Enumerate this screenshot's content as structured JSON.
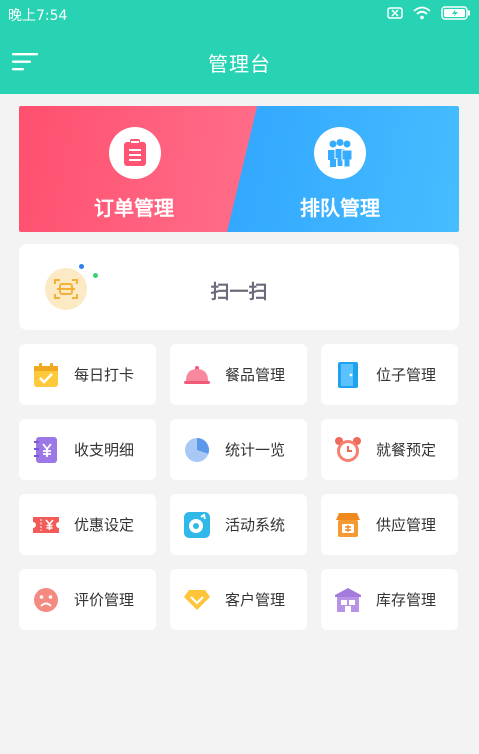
{
  "status_bar": {
    "time": "晚上7:54"
  },
  "header": {
    "title": "管理台"
  },
  "hero": {
    "left_label": "订单管理",
    "right_label": "排队管理"
  },
  "scan": {
    "label": "扫一扫"
  },
  "grid": [
    {
      "label": "每日打卡",
      "icon": "calendar-check-icon"
    },
    {
      "label": "餐品管理",
      "icon": "food-cloche-icon"
    },
    {
      "label": "位子管理",
      "icon": "door-icon"
    },
    {
      "label": "收支明细",
      "icon": "ledger-yen-icon"
    },
    {
      "label": "统计一览",
      "icon": "pie-chart-icon"
    },
    {
      "label": "就餐预定",
      "icon": "alarm-clock-icon"
    },
    {
      "label": "优惠设定",
      "icon": "coupon-yen-icon"
    },
    {
      "label": "活动系统",
      "icon": "activity-disc-icon"
    },
    {
      "label": "供应管理",
      "icon": "supply-shop-icon"
    },
    {
      "label": "评价管理",
      "icon": "sad-face-icon"
    },
    {
      "label": "客户管理",
      "icon": "diamond-icon"
    },
    {
      "label": "库存管理",
      "icon": "warehouse-icon"
    }
  ],
  "colors": {
    "primary": "#27d3b3",
    "hero_left": "#ff5572",
    "hero_right": "#36acff"
  }
}
